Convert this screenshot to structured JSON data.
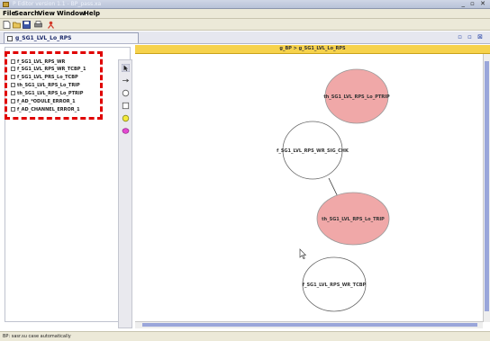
{
  "window": {
    "title": "P Editor version 1.1 - BP_pass.xa",
    "controls": "_ ▫ ✕"
  },
  "menu": {
    "items": [
      "File",
      "Search",
      "View",
      "Window",
      "Help"
    ]
  },
  "toolbar": {
    "icons": [
      "new-document-icon",
      "open-folder-icon",
      "save-icon",
      "print-icon",
      "person-icon"
    ]
  },
  "document_tab": {
    "label": "g_SG1_LVL_Lo_RPS",
    "controls": "▫ ▫ ⊠"
  },
  "breadcrumb": "g_BP > g_SG1_LVL_Lo_RPS",
  "left_panel": {
    "items": [
      "f_SG1_LVL_RPS_WR",
      "f_SG1_LVL_RPS_WR_TCBP_1",
      "f_SG1_LVL_PRS_Lo_TCBP",
      "th_SG1_LVL_RPS_Lo_TRIP",
      "th_SG1_LVL_RPS_Lo_PTRIP",
      "f_AD_*ODULE_ERROR_1",
      "f_AD_CHANNEL_ERROR_1"
    ]
  },
  "palette": {
    "tools": [
      "arrow-select-icon",
      "transition-arrow-icon",
      "circle-state-icon",
      "square-state-icon",
      "yellow-circle-icon",
      "pink-circle-icon"
    ]
  },
  "diagram": {
    "nodes": [
      {
        "id": "th_ptrip",
        "label": "th_SG1_LVL_RPS_Lo_PTRIP",
        "style": "filled"
      },
      {
        "id": "f_sig_chk",
        "label": "f_SG1_LVL_RPS_WR_SIG_CHK",
        "style": "outline"
      },
      {
        "id": "th_trip",
        "label": "th_SG1_LVL_RPS_Lo_TRIP",
        "style": "filled"
      },
      {
        "id": "f_tcbp",
        "label": "f_SG1_LVL_RPS_WR_TCBP",
        "style": "outline"
      }
    ],
    "edges": [
      {
        "from": "f_sig_chk",
        "to": "th_trip"
      }
    ]
  },
  "status": {
    "text": "BP: sasr.su case automatically"
  },
  "colors": {
    "filled_node": "#f0a8a8",
    "breadcrumb_bar": "#f6d24c",
    "highlight_box": "#e00000",
    "scroll_thumb": "#9aa6da"
  }
}
